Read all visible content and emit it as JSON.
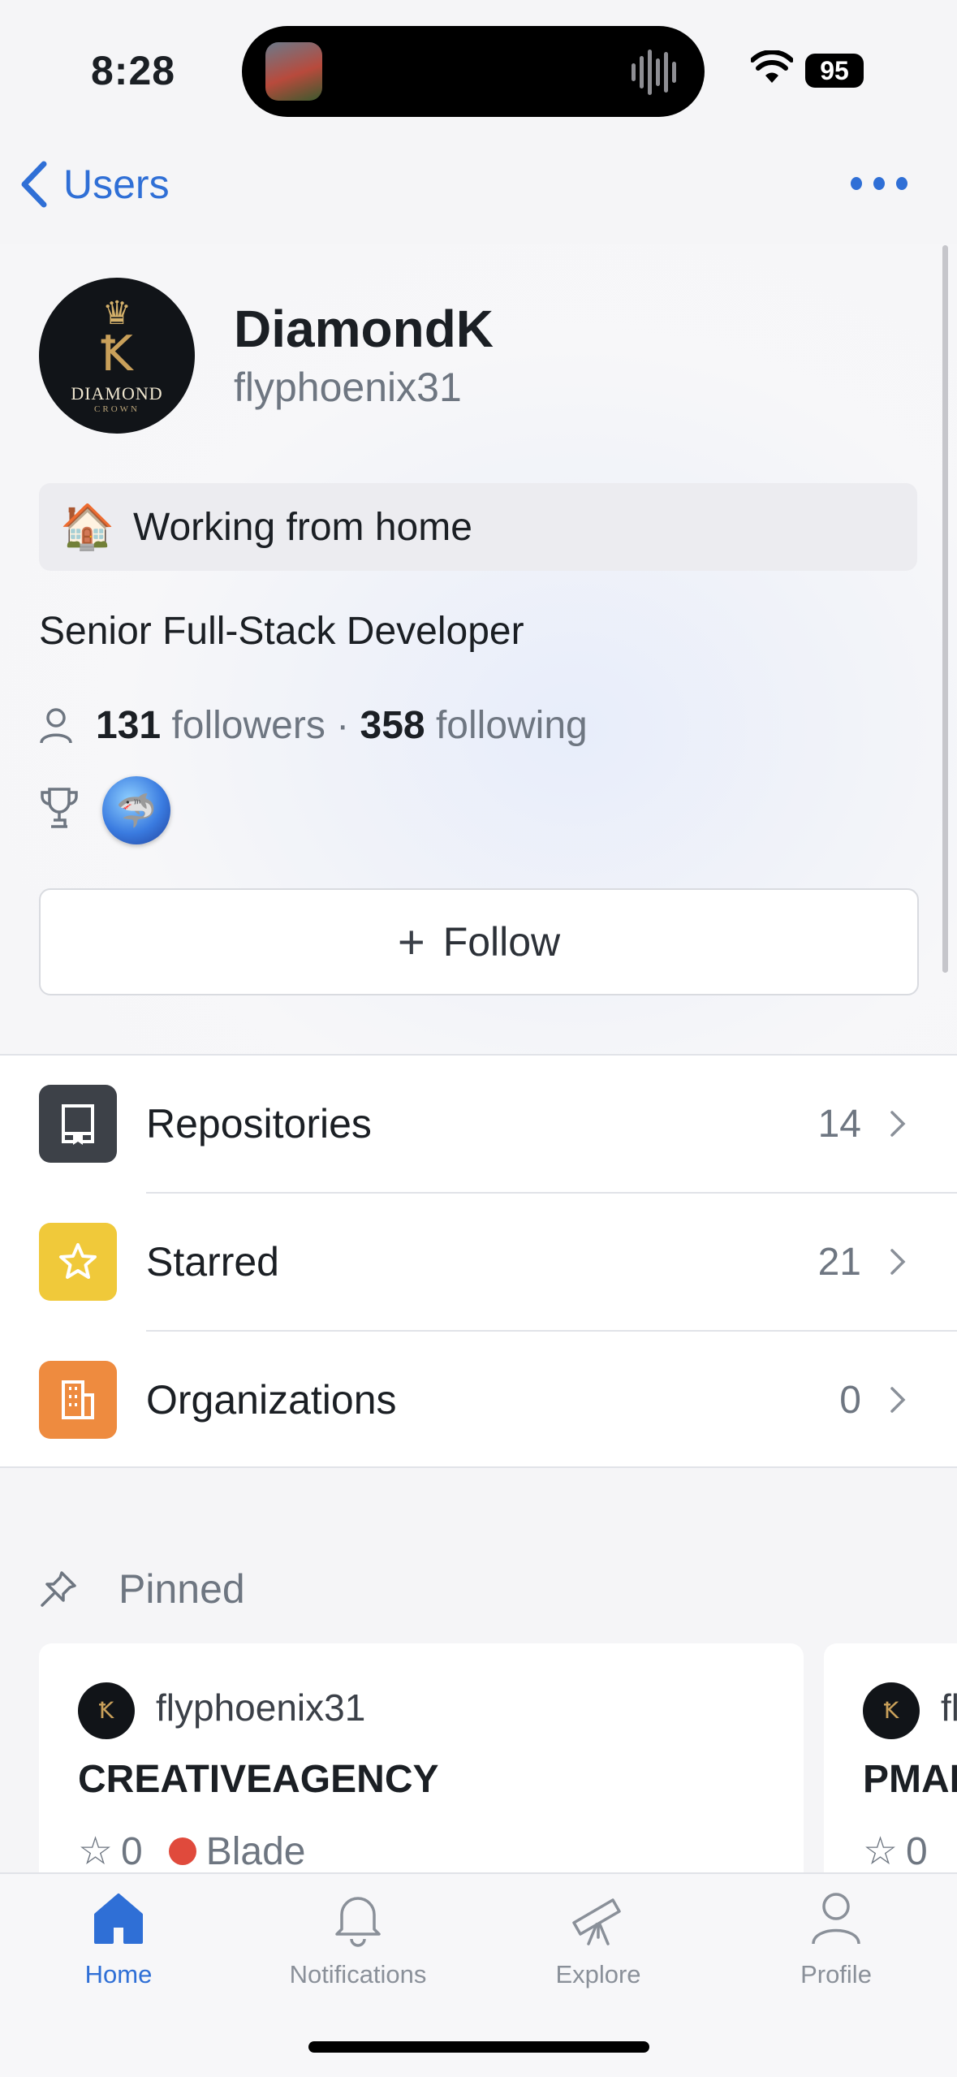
{
  "status_bar": {
    "time": "8:28",
    "battery": "95"
  },
  "nav": {
    "back_label": "Users"
  },
  "profile": {
    "avatar_brand": "DIAMOND",
    "avatar_brand_sub": "CROWN",
    "display_name": "DiamondK",
    "username": "flyphoenix31",
    "status_emoji": "🏠",
    "status_text": "Working from home",
    "bio": "Senior Full-Stack Developer",
    "followers_count": "131",
    "followers_label": "followers",
    "separator": "·",
    "following_count": "358",
    "following_label": "following",
    "follow_button": "Follow"
  },
  "list": [
    {
      "label": "Repositories",
      "count": "14",
      "color": "#3d4148"
    },
    {
      "label": "Starred",
      "count": "21",
      "color": "#f0c93a"
    },
    {
      "label": "Organizations",
      "count": "0",
      "color": "#ee8b3f"
    }
  ],
  "pinned": {
    "heading": "Pinned",
    "cards": [
      {
        "owner": "flyphoenix31",
        "title": "CREATIVEAGENCY",
        "stars": "0",
        "language": "Blade",
        "language_color": "#e04a3c"
      },
      {
        "owner": "fl",
        "title": "PMAI",
        "stars": "0"
      }
    ]
  },
  "tabs": [
    {
      "label": "Home",
      "icon": "home-icon",
      "active": true
    },
    {
      "label": "Notifications",
      "icon": "bell-icon",
      "active": false
    },
    {
      "label": "Explore",
      "icon": "telescope-icon",
      "active": false
    },
    {
      "label": "Profile",
      "icon": "person-icon",
      "active": false
    }
  ],
  "colors": {
    "accent": "#2f6fd6",
    "muted": "#6e7681"
  }
}
